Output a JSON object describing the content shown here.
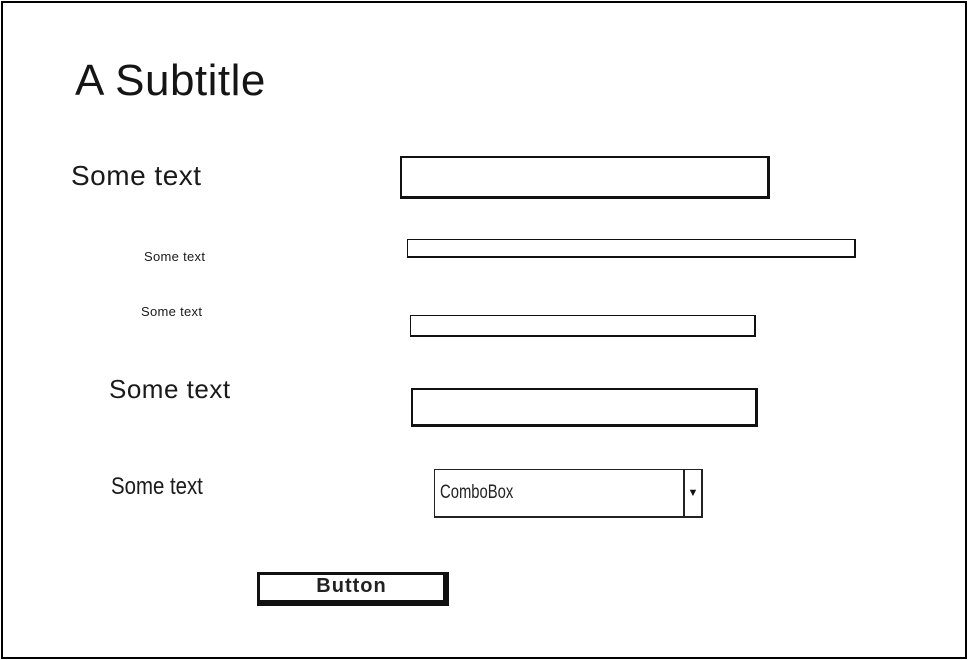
{
  "page": {
    "subtitle": "A Subtitle"
  },
  "form": {
    "rows": [
      {
        "label": "Some text",
        "value": ""
      },
      {
        "label": "Some text",
        "value": ""
      },
      {
        "label": "Some text",
        "value": ""
      },
      {
        "label": "Some text",
        "value": ""
      }
    ],
    "combo": {
      "label": "Some text",
      "value": "ComboBox",
      "icon": "dropdown-arrow-icon"
    },
    "button_label": "Button"
  }
}
